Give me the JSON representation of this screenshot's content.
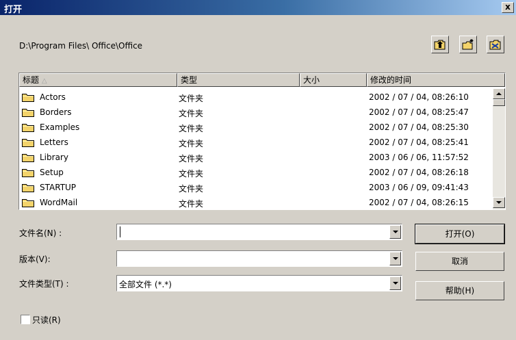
{
  "window": {
    "title": "打开",
    "close_label": "x"
  },
  "path": "D:\\Program Files\\ Office\\Office",
  "toolbar": {
    "buttons": [
      {
        "name": "up-folder-icon"
      },
      {
        "name": "new-folder-icon"
      },
      {
        "name": "default-folder-icon"
      }
    ]
  },
  "filelist": {
    "columns": [
      "标题",
      "类型",
      "大小",
      "修改的时间"
    ],
    "sort_indicator": "△",
    "rows": [
      {
        "name": "Actors",
        "type": "文件夹",
        "size": "",
        "modified": "2002 / 07 / 04, 08:26:10"
      },
      {
        "name": "Borders",
        "type": "文件夹",
        "size": "",
        "modified": "2002 / 07 / 04, 08:25:47"
      },
      {
        "name": "Examples",
        "type": "文件夹",
        "size": "",
        "modified": "2002 / 07 / 04, 08:25:30"
      },
      {
        "name": "Letters",
        "type": "文件夹",
        "size": "",
        "modified": "2002 / 07 / 04, 08:25:41"
      },
      {
        "name": "Library",
        "type": "文件夹",
        "size": "",
        "modified": "2003 / 06 / 06, 11:57:52"
      },
      {
        "name": "Setup",
        "type": "文件夹",
        "size": "",
        "modified": "2002 / 07 / 04, 08:26:18"
      },
      {
        "name": "STARTUP",
        "type": "文件夹",
        "size": "",
        "modified": "2003 / 06 / 09, 09:41:43"
      },
      {
        "name": "WordMail",
        "type": "文件夹",
        "size": "",
        "modified": "2002 / 07 / 04, 08:26:15"
      }
    ]
  },
  "form": {
    "filename_label": "文件名(N) :",
    "filename_value": "",
    "version_label": "版本(V):",
    "version_value": "",
    "filetype_label": "文件类型(T) :",
    "filetype_value": "全部文件 (*.*)"
  },
  "buttons": {
    "open": "打开(O)",
    "cancel": "取消",
    "help": "帮助(H)"
  },
  "readonly": {
    "label": "只读(R)",
    "checked": false
  },
  "colors": {
    "face": "#d4d0c8",
    "title_start": "#0a246a",
    "title_end": "#a6caf0",
    "folder": "#f3d36a"
  }
}
